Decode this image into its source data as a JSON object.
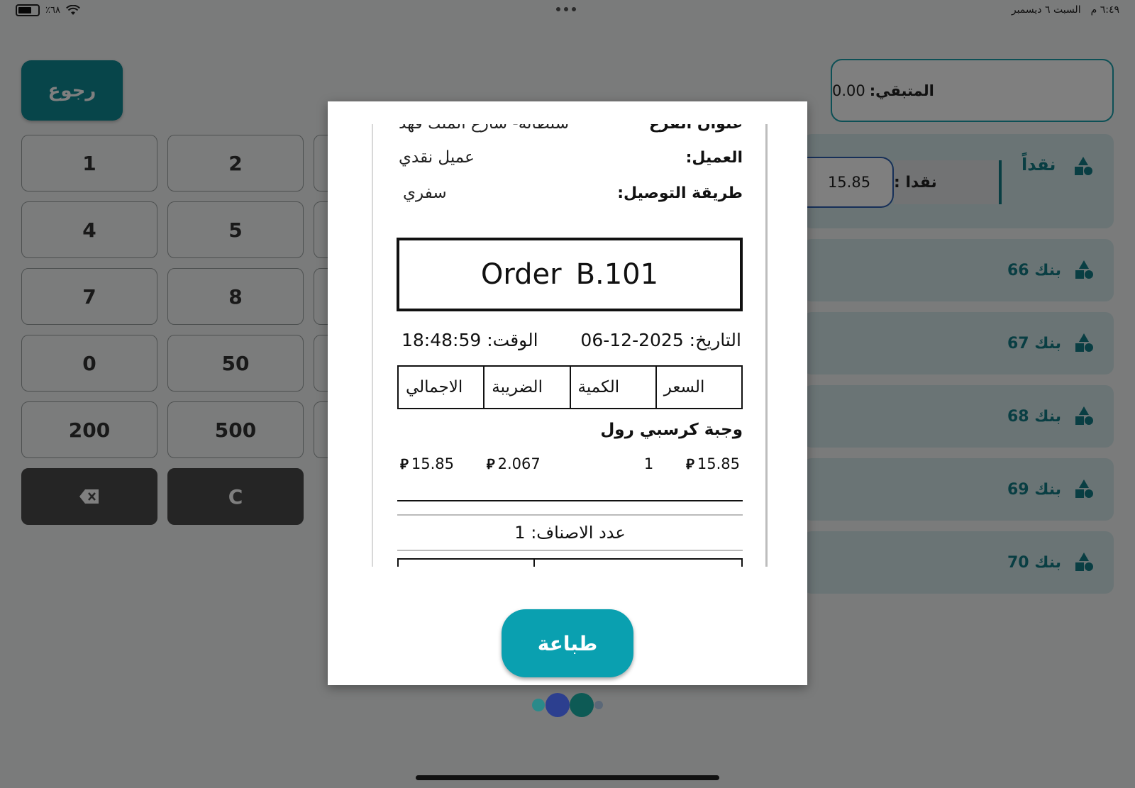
{
  "status_bar": {
    "battery_percent": "٪٦٨",
    "battery_level": 0.68,
    "time": "٦:٤٩ م",
    "date": "السبت ٦ ديسمبر"
  },
  "header": {
    "back_label": "رجوع",
    "remaining_label": "المتبقي:",
    "remaining_value": "0.00"
  },
  "keypad": [
    "1",
    "2",
    "4",
    "5",
    "7",
    "8",
    "0",
    "50",
    "200",
    "500"
  ],
  "keypad_clear": "C",
  "payments": {
    "cash_title": "نقداً",
    "cash_field_label": "نقدا :",
    "cash_value": "15.85",
    "banks": [
      "بنك 66",
      "بنك 67",
      "بنك 68",
      "بنك 69",
      "بنك 70"
    ]
  },
  "receipt": {
    "branch_label": "عنوان الفرع",
    "branch_value": "سلطانه- شارع الملك فهد",
    "customer_label": "العميل:",
    "customer_value": "عميل نقدي",
    "delivery_label": "طريقة التوصيل:",
    "delivery_value": "سفري",
    "order_word": "Order",
    "order_number": "B.101",
    "date_text": "التاريخ: 2025-12-06",
    "time_text": "الوقت: 18:48:59",
    "columns": [
      "السعر",
      "الكمية",
      "الضريبة",
      "الاجمالي"
    ],
    "item_name": "وجبة كرسبي رول",
    "item_price": "15.85",
    "item_qty": "1",
    "item_tax": "2.067",
    "item_total": "15.85",
    "items_count_text": "عدد الاصناف: 1",
    "currency_symbol": "⃁"
  },
  "print_label": "طباعة"
}
